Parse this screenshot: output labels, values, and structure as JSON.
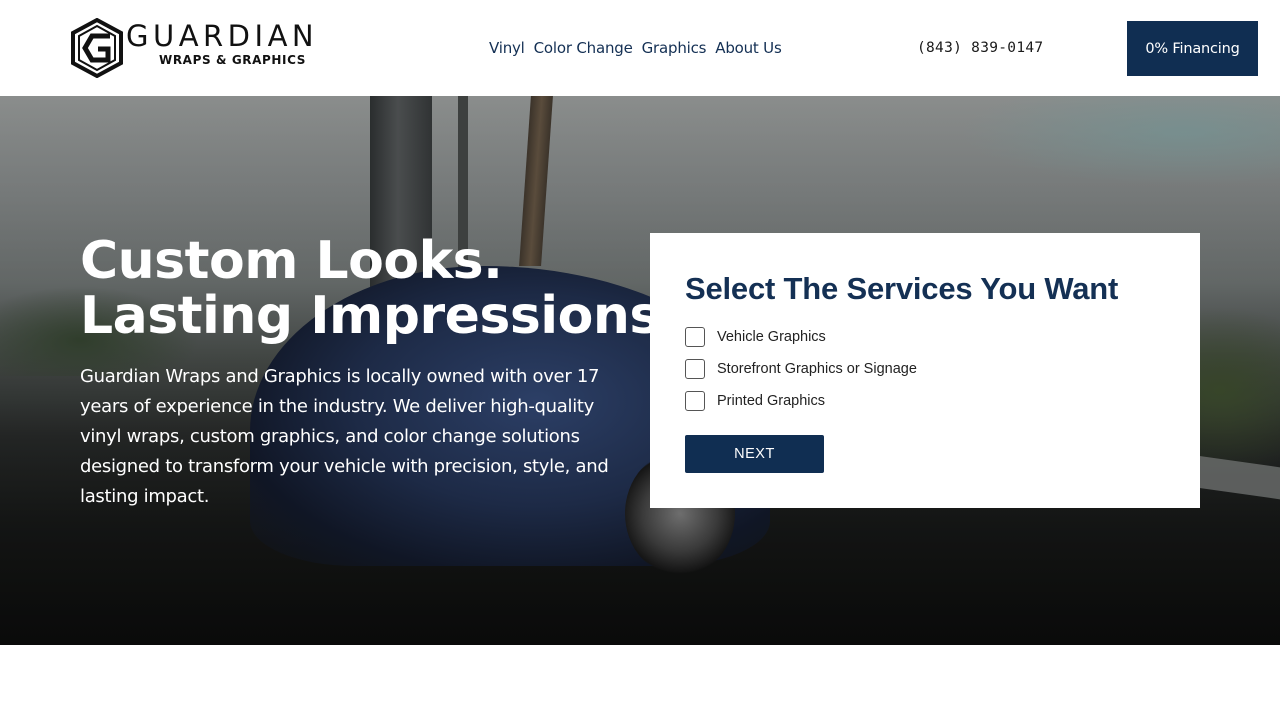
{
  "brand": {
    "name": "GUARDIAN",
    "tagline": "WRAPS & GRAPHICS"
  },
  "nav": {
    "items": [
      {
        "label": "Vinyl"
      },
      {
        "label": "Color Change"
      },
      {
        "label": "Graphics"
      },
      {
        "label": "About Us"
      }
    ]
  },
  "header": {
    "phone": "(843) 839-0147",
    "financing_label": "0% Financing"
  },
  "hero": {
    "title_line1": "Custom Looks.",
    "title_line2": "Lasting Impressions",
    "description": "Guardian Wraps and Graphics is locally owned with over 17 years of experience in the industry. We deliver high-quality vinyl wraps, custom graphics, and color change solutions designed to transform your vehicle with precision, style, and lasting impact."
  },
  "form": {
    "title": "Select The Services You Want",
    "options": [
      {
        "label": "Vehicle Graphics",
        "checked": false
      },
      {
        "label": "Storefront Graphics or Signage",
        "checked": false
      },
      {
        "label": "Printed Graphics",
        "checked": false
      }
    ],
    "next_label": "NEXT"
  },
  "colors": {
    "primary": "#102e52",
    "nav_text": "#143054",
    "white": "#ffffff"
  }
}
